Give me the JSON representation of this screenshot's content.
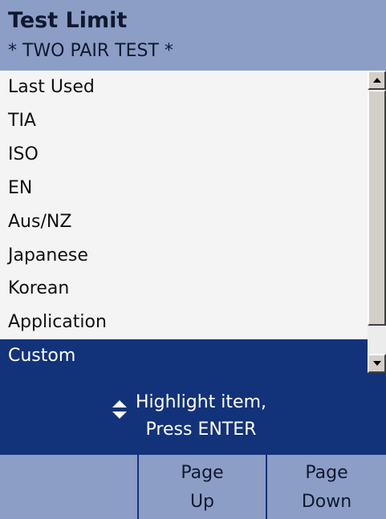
{
  "header": {
    "title": "Test Limit",
    "subtitle": "* TWO PAIR TEST *"
  },
  "list": {
    "items": [
      {
        "label": "Last Used",
        "selected": false
      },
      {
        "label": "TIA",
        "selected": false
      },
      {
        "label": "ISO",
        "selected": false
      },
      {
        "label": "EN",
        "selected": false
      },
      {
        "label": "Aus/NZ",
        "selected": false
      },
      {
        "label": "Japanese",
        "selected": false
      },
      {
        "label": "Korean",
        "selected": false
      },
      {
        "label": "Application",
        "selected": false
      },
      {
        "label": "Custom",
        "selected": true
      }
    ]
  },
  "instruction": {
    "line1": "Highlight item,",
    "line2": "Press ENTER",
    "icon": "up-down-arrows-icon"
  },
  "softkeys": [
    {
      "line1": "",
      "line2": ""
    },
    {
      "line1": "Page",
      "line2": "Up"
    },
    {
      "line1": "Page",
      "line2": "Down"
    }
  ],
  "colors": {
    "header_bg": "#8c9ec6",
    "selection_bg": "#12327a",
    "list_bg": "#f4f4f4"
  }
}
